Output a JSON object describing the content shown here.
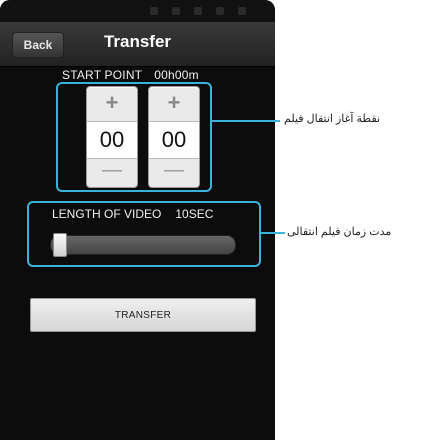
{
  "header": {
    "back_label": "Back",
    "title": "Transfer"
  },
  "start_point": {
    "label": "START POINT",
    "time": "00h00m",
    "spinners": [
      {
        "plus": "+",
        "value": "00",
        "minus": "—"
      },
      {
        "plus": "+",
        "value": "00",
        "minus": "—"
      }
    ]
  },
  "length": {
    "label": "LENGTH OF VIDEO",
    "value": "10SEC",
    "slider_level": 0.0
  },
  "transfer_label": "TRANSFER",
  "callouts": [
    {
      "text": "نقطة آغاز انتقال فیلم"
    },
    {
      "text": "مدت زمان فیلم انتقالی"
    }
  ],
  "colors": {
    "highlight": "#3ab3d8"
  }
}
